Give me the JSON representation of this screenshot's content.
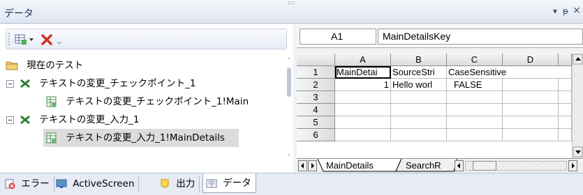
{
  "window": {
    "title": "データ",
    "controls": [
      "▾",
      "ᵽ",
      "×"
    ]
  },
  "toolbar": {
    "icons": [
      "grid-dropdown-icon",
      "delete-icon",
      "overflow-chevron-icon"
    ]
  },
  "tree": {
    "items": [
      {
        "label": "現在のテスト",
        "icon": "folder-icon",
        "level": 0
      },
      {
        "label": "テキストの変更_チェックポイント_1",
        "icon": "action-x-icon",
        "level": 0,
        "expanded": true
      },
      {
        "label": "テキストの変更_チェックポイント_1!Main",
        "icon": "datasheet-icon",
        "level": 1
      },
      {
        "label": "テキストの変更_入力_1",
        "icon": "action-x-icon",
        "level": 0,
        "expanded": true
      },
      {
        "label": "テキストの変更_入力_1!MainDetails",
        "icon": "datasheet-icon",
        "level": 1,
        "selected": true
      }
    ]
  },
  "sheet": {
    "cell_ref": "A1",
    "formula": "MainDetailsKey",
    "columns": [
      "A",
      "B",
      "C",
      "D"
    ],
    "rows": [
      {
        "num": "1",
        "cells": [
          "MainDetai",
          "SourceStri",
          "CaseSensitive",
          ""
        ]
      },
      {
        "num": "2",
        "cells": [
          "1",
          "Hello worl",
          "FALSE",
          ""
        ]
      },
      {
        "num": "3",
        "cells": [
          "",
          "",
          "",
          ""
        ]
      },
      {
        "num": "4",
        "cells": [
          "",
          "",
          "",
          ""
        ]
      },
      {
        "num": "5",
        "cells": [
          "",
          "",
          "",
          ""
        ]
      },
      {
        "num": "6",
        "cells": [
          "",
          "",
          "",
          ""
        ]
      }
    ],
    "tabs": [
      "MainDetails",
      "SearchR"
    ]
  },
  "bottom_tabs": [
    {
      "label": "エラー",
      "icon": "error-icon"
    },
    {
      "label": "ActiveScreen",
      "icon": "active-screen-icon"
    },
    {
      "label": "出力",
      "icon": "output-icon"
    },
    {
      "label": "データ",
      "icon": "data-icon",
      "active": true
    }
  ],
  "colors": {
    "accent": "#1e3157",
    "action_green": "#2e7d32",
    "delete_red": "#d32f2f",
    "selection": "#dcdcdc"
  }
}
